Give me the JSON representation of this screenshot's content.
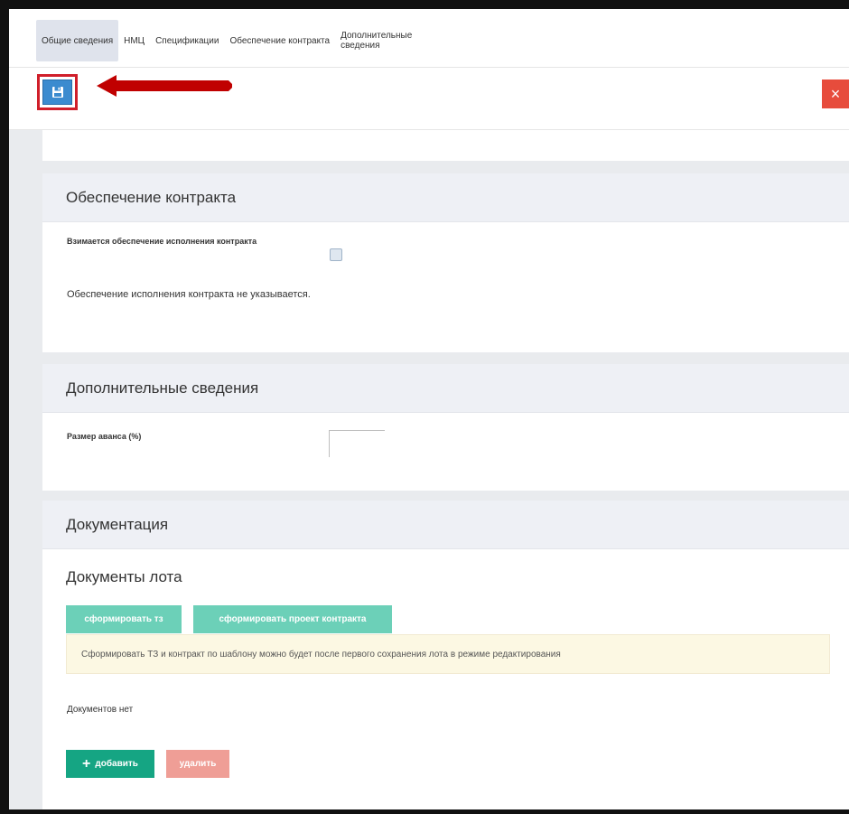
{
  "tabs": [
    {
      "label": "Общие сведения"
    },
    {
      "label": "НМЦ"
    },
    {
      "label": "Спецификации"
    },
    {
      "label": "Обеспечение контракта"
    },
    {
      "label": "Дополнительные сведения"
    }
  ],
  "toolbar": {
    "save_icon": "floppy-disk-icon",
    "close_label": "×"
  },
  "colors": {
    "save_button": "#3b8bcf",
    "close_button": "#e74c3c",
    "arrow": "#c00000",
    "teal_button": "#6cd0b8",
    "add_button": "#15a583",
    "delete_button": "#ef9e96"
  },
  "contract_security": {
    "title": "Обеспечение контракта",
    "checkbox_label": "Взимается обеспечение исполнения контракта",
    "checked": false,
    "note": "Обеспечение исполнения контракта не указывается."
  },
  "additional_info": {
    "title": "Дополнительные сведения",
    "advance_label": "Размер аванса (%)",
    "advance_value": ""
  },
  "documentation": {
    "title": "Документация",
    "lot_docs_title": "Документы лота",
    "generate_tz_label": "сформировать тз",
    "generate_contract_label": "сформировать проект контракта",
    "warning": "Сформировать ТЗ и контракт по шаблону можно будет после первого сохранения лота в режиме редактирования",
    "empty_text": "Документов нет",
    "add_label": "добавить",
    "delete_label": "удалить"
  }
}
